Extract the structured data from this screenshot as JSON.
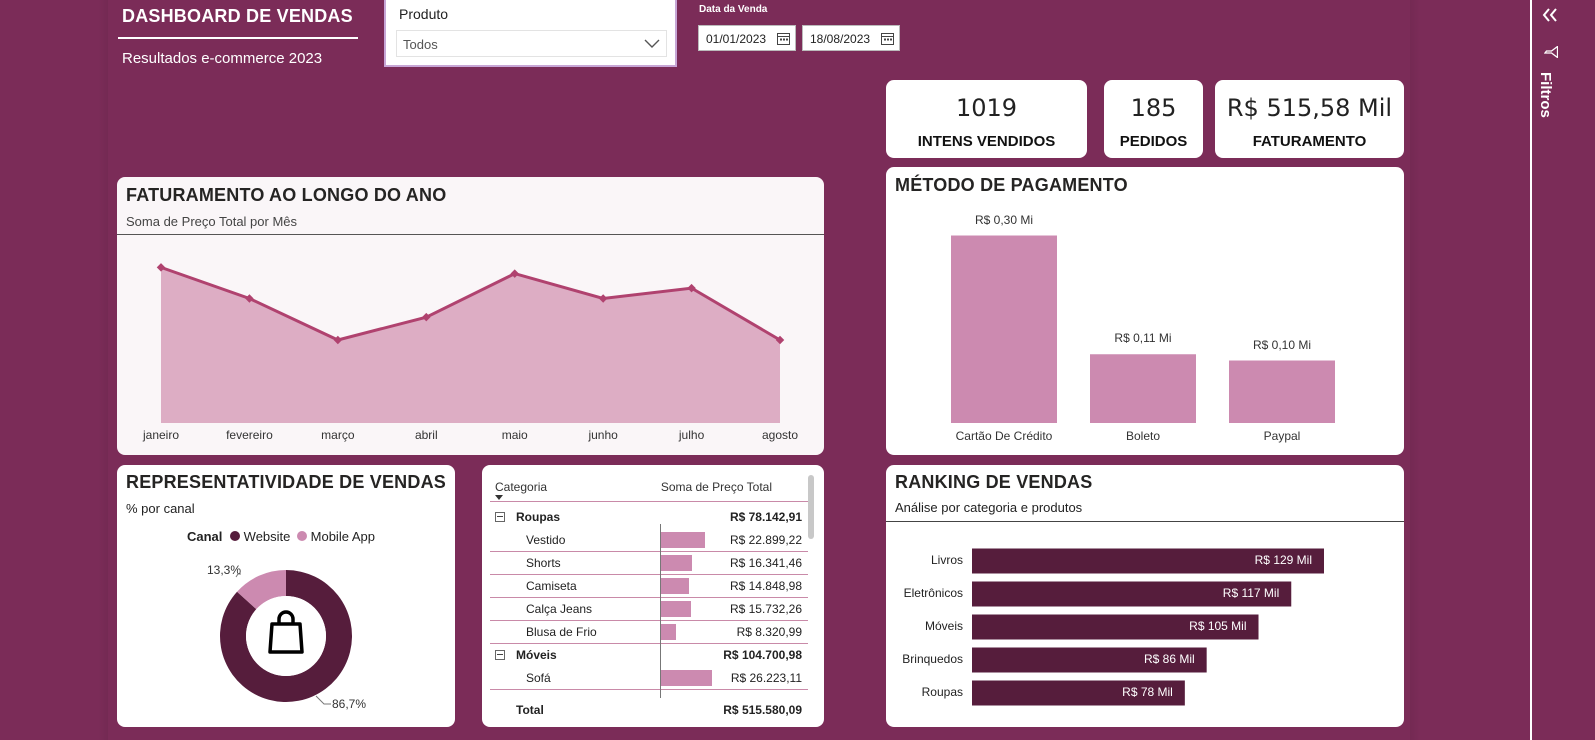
{
  "header": {
    "title": "DASHBOARD DE VENDAS",
    "subtitle": "Resultados e-commerce 2023"
  },
  "product_slicer": {
    "label": "Produto",
    "selected": "Todos"
  },
  "date_filter": {
    "label": "Data da Venda",
    "start": "01/01/2023",
    "end": "18/08/2023"
  },
  "kpis": [
    {
      "value": "1019",
      "caption": "INTENS VENDIDOS"
    },
    {
      "value": "185",
      "caption": "PEDIDOS"
    },
    {
      "value": "R$ 515,58 Mil",
      "caption": "FATURAMENTO"
    }
  ],
  "colors": {
    "background": "#7b2c58",
    "area_fill": "#ddadc4",
    "line": "#b0426f",
    "bar_light": "#cc8ab0",
    "bar_dark": "#561d3c"
  },
  "side_pane": {
    "label": "Filtros",
    "collapse_icon": "double-chevron-left-icon",
    "filter_icon": "funnel-icon"
  },
  "revenue_chart": {
    "title": "FATURAMENTO AO LONGO DO ANO",
    "subtitle": "Soma de Preço Total por Mês"
  },
  "payment_chart": {
    "title": "MÉTODO DE PAGAMENTO"
  },
  "channel_chart": {
    "title": "REPRESENTATIVIDADE DE VENDAS",
    "subtitle": "% por canal",
    "legend_title": "Canal",
    "center_icon": "shopping-bag-icon"
  },
  "category_table": {
    "header_category": "Categoria",
    "header_sum": "Soma de Preço Total",
    "rows": [
      {
        "type": "group",
        "label": "Roupas",
        "value": "R$ 78.142,91"
      },
      {
        "type": "item",
        "label": "Vestido",
        "value": "R$ 22.899,22",
        "fraction": 0.873
      },
      {
        "type": "item",
        "label": "Shorts",
        "value": "R$ 16.341,46",
        "fraction": 0.623
      },
      {
        "type": "item",
        "label": "Camiseta",
        "value": "R$ 14.848,98",
        "fraction": 0.566
      },
      {
        "type": "item",
        "label": "Calça Jeans",
        "value": "R$ 15.732,26",
        "fraction": 0.6
      },
      {
        "type": "item",
        "label": "Blusa de Frio",
        "value": "R$ 8.320,99",
        "fraction": 0.317
      },
      {
        "type": "group",
        "label": "Móveis",
        "value": "R$ 104.700,98"
      },
      {
        "type": "item",
        "label": "Sofá",
        "value": "R$ 26.223,11",
        "fraction": 1.0
      }
    ],
    "total_label": "Total",
    "total_value": "R$ 515.580,09"
  },
  "ranking_chart": {
    "title": "RANKING DE VENDAS",
    "subtitle": "Análise por categoria e produtos"
  },
  "chart_data": [
    {
      "type": "area",
      "title": "FATURAMENTO AO LONGO DO ANO",
      "subtitle": "Soma de Preço Total por Mês",
      "categories": [
        "janeiro",
        "fevereiro",
        "março",
        "abril",
        "maio",
        "junho",
        "julho",
        "agosto"
      ],
      "values": [
        75,
        60,
        40,
        51,
        72,
        60,
        65,
        40
      ],
      "ylim": [
        0,
        80
      ],
      "xlabel": "",
      "ylabel": "",
      "grid": false
    },
    {
      "type": "bar",
      "title": "MÉTODO DE PAGAMENTO",
      "categories": [
        "Cartão De Crédito",
        "Boleto",
        "Paypal"
      ],
      "values": [
        0.3,
        0.11,
        0.1
      ],
      "data_labels": [
        "R$ 0,30 Mi",
        "R$ 0,11 Mi",
        "R$ 0,10 Mi"
      ],
      "ylim": [
        0,
        0.32
      ],
      "grid": false
    },
    {
      "type": "pie",
      "title": "REPRESENTATIVIDADE DE VENDAS",
      "subtitle": "% por canal",
      "legend_title": "Canal",
      "legend_position": "top",
      "categories": [
        "Website",
        "Mobile App"
      ],
      "values": [
        86.7,
        13.3
      ],
      "data_labels": [
        "86,7%",
        "13,3%"
      ]
    },
    {
      "type": "bar",
      "orientation": "horizontal",
      "title": "RANKING DE VENDAS",
      "subtitle": "Análise por categoria e produtos",
      "categories": [
        "Livros",
        "Eletrônicos",
        "Móveis",
        "Brinquedos",
        "Roupas"
      ],
      "values": [
        129,
        117,
        105,
        86,
        78
      ],
      "data_labels": [
        "R$ 129 Mil",
        "R$ 117 Mil",
        "R$ 105 Mil",
        "R$ 86 Mil",
        "R$ 78 Mil"
      ],
      "xlim": [
        0,
        140
      ],
      "grid": false
    }
  ]
}
